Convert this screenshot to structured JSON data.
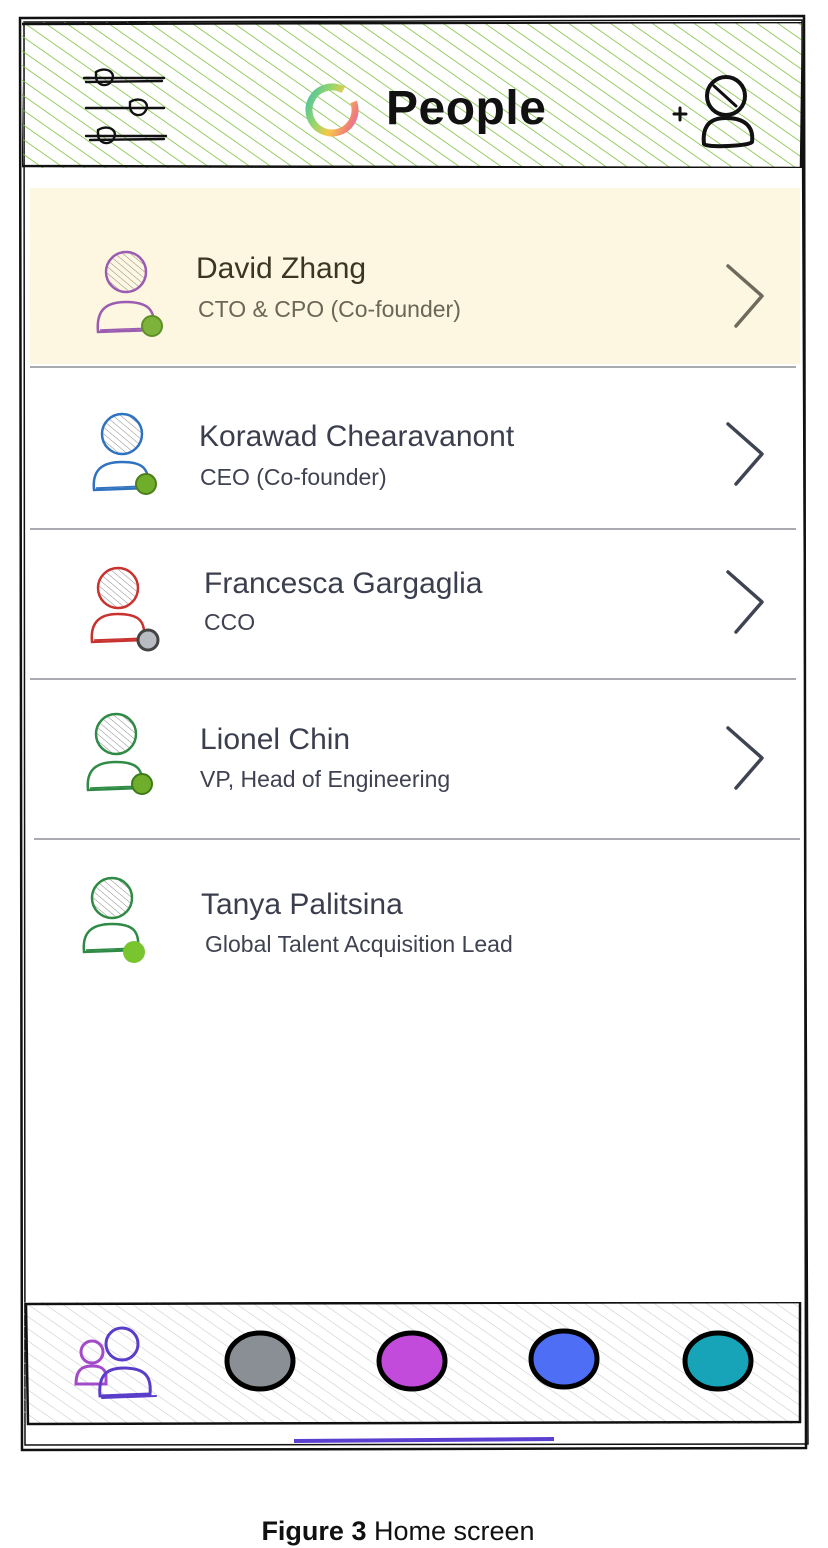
{
  "header": {
    "title": "People",
    "header_color": "#7cc240",
    "filter_icon": "sliders-icon",
    "logo_icon": "rainbow-ring-logo",
    "add_user_icon": "add-person-icon",
    "add_symbol": "+"
  },
  "people": [
    {
      "name": "David Zhang",
      "role": "CTO & CPO (Co-founder)",
      "avatar_color": "#9a5bb0",
      "status_color": "#7db33a",
      "selected": true,
      "has_chevron": true
    },
    {
      "name": "Korawad Chearavanont",
      "role": "CEO (Co-founder)",
      "avatar_color": "#2f72c0",
      "status_color": "#6fae2a",
      "selected": false,
      "has_chevron": true
    },
    {
      "name": "Francesca Gargaglia",
      "role": "CCO",
      "avatar_color": "#c8322f",
      "status_color": "#b9bcc2",
      "selected": false,
      "has_chevron": true
    },
    {
      "name": "Lionel Chin",
      "role": "VP, Head of Engineering",
      "avatar_color": "#2f8a45",
      "status_color": "#6fae2a",
      "selected": false,
      "has_chevron": true
    },
    {
      "name": "Tanya Palitsina",
      "role": "Global Talent Acquisition Lead",
      "avatar_color": "#2f8a45",
      "status_color": "#79c52f",
      "selected": false,
      "has_chevron": false
    }
  ],
  "tab_bar": {
    "tabs": [
      {
        "name": "people-tab",
        "icon": "people-icon",
        "color": "#7a3ec9"
      },
      {
        "name": "tab-2",
        "icon": "gray-dot",
        "color": "#8a8f96"
      },
      {
        "name": "tab-3",
        "icon": "purple-dot",
        "color": "#c24bdc"
      },
      {
        "name": "tab-4",
        "icon": "blue-dot",
        "color": "#4d6ef5"
      },
      {
        "name": "tab-5",
        "icon": "teal-dot",
        "color": "#17a4b8"
      }
    ],
    "home_indicator_color": "#5b3fd0"
  },
  "caption": {
    "label": "Figure 3",
    "text": " Home screen"
  }
}
